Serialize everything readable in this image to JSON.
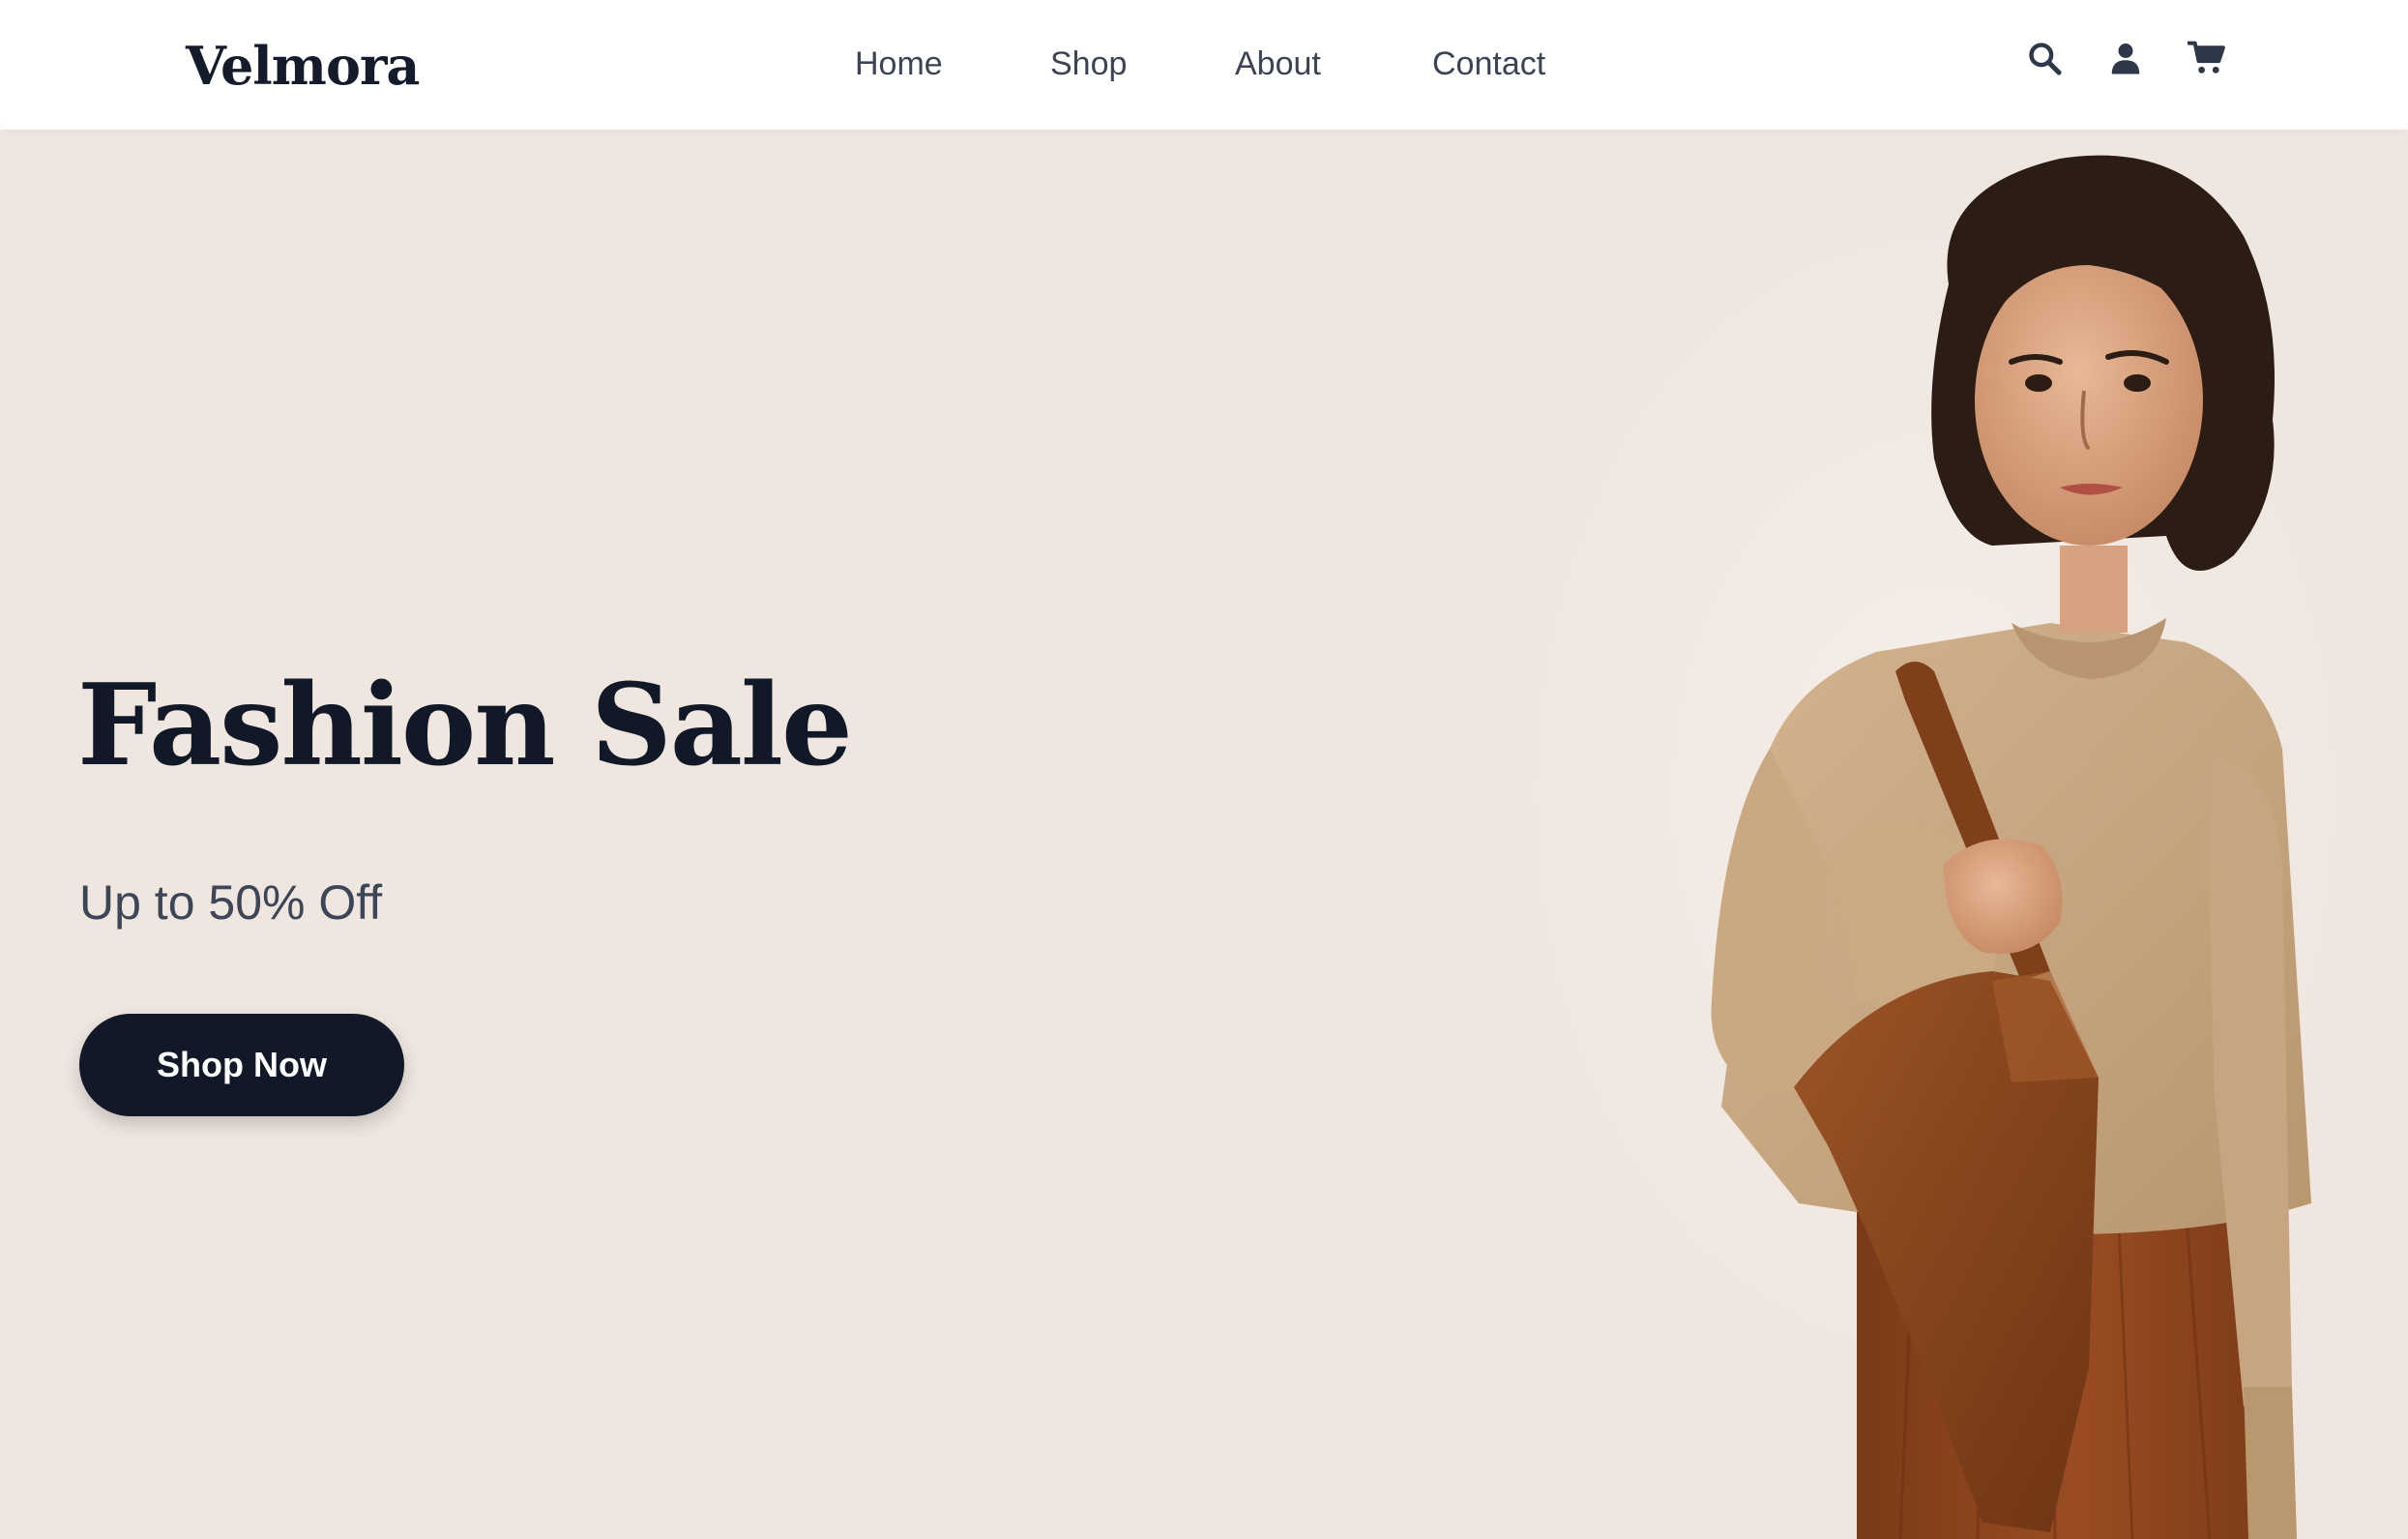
{
  "header": {
    "logo": "Velmora",
    "nav": [
      {
        "label": "Home"
      },
      {
        "label": "Shop"
      },
      {
        "label": "About"
      },
      {
        "label": "Contact"
      }
    ],
    "icons": [
      "search-icon",
      "user-icon",
      "cart-icon"
    ]
  },
  "hero": {
    "title": "Fashion Sale",
    "subtitle": "Up to 50% Off",
    "cta_label": "Shop Now",
    "image_subject": "model-with-bag"
  },
  "colors": {
    "hero_background": "#efe6df",
    "dark": "#111827",
    "nav_text": "#3c4454",
    "sweater": "#c9a987",
    "bag": "#8a4a22"
  }
}
